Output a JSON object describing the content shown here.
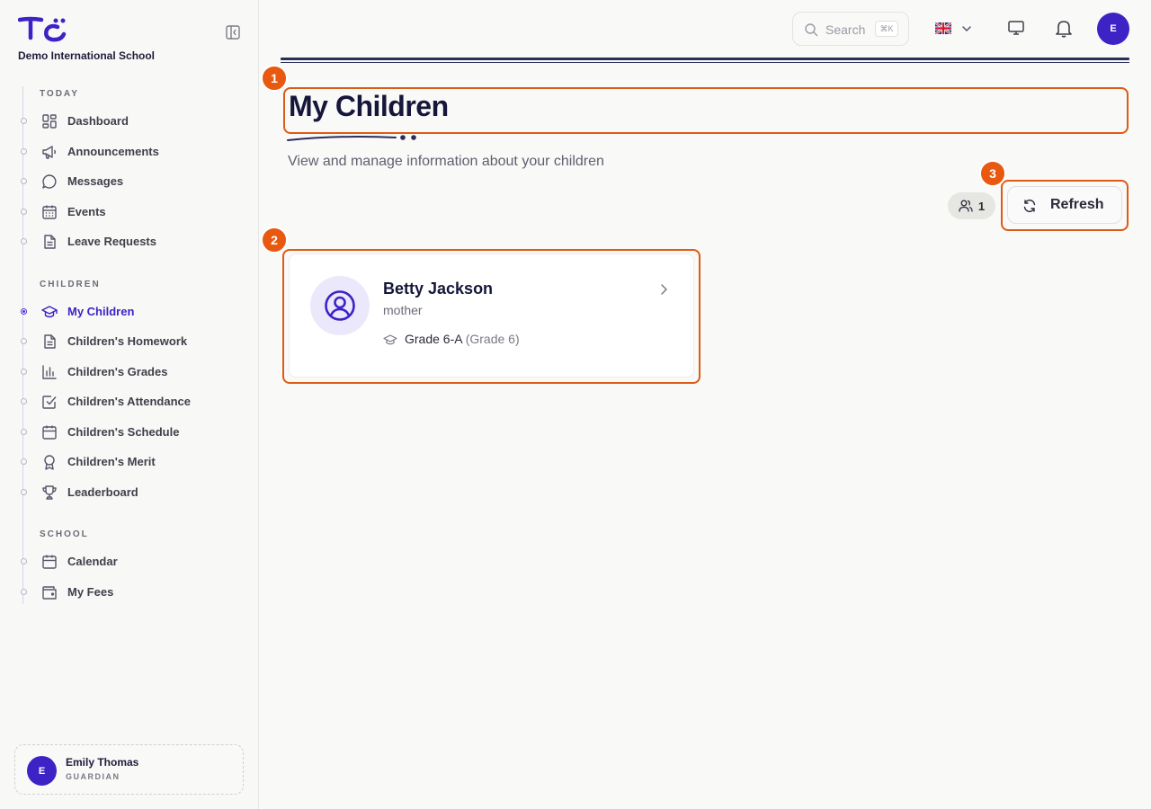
{
  "sidebar": {
    "school_name": "Demo International School",
    "sections": {
      "today": "TODAY",
      "children": "CHILDREN",
      "school": "SCHOOL"
    },
    "items": [
      {
        "label": "Dashboard",
        "icon": "dashboard-icon"
      },
      {
        "label": "Announcements",
        "icon": "megaphone-icon"
      },
      {
        "label": "Messages",
        "icon": "chat-bubble-icon"
      },
      {
        "label": "Events",
        "icon": "calendar-grid-icon"
      },
      {
        "label": "Leave Requests",
        "icon": "document-icon"
      },
      {
        "label": "My Children",
        "icon": "graduation-cap-icon",
        "active": true
      },
      {
        "label": "Children's Homework",
        "icon": "document-icon"
      },
      {
        "label": "Children's Grades",
        "icon": "bar-chart-icon"
      },
      {
        "label": "Children's Attendance",
        "icon": "checkbox-icon"
      },
      {
        "label": "Children's Schedule",
        "icon": "calendar-icon"
      },
      {
        "label": "Children's Merit",
        "icon": "award-icon"
      },
      {
        "label": "Leaderboard",
        "icon": "trophy-icon"
      },
      {
        "label": "Calendar",
        "icon": "calendar-icon"
      },
      {
        "label": "My Fees",
        "icon": "wallet-icon"
      }
    ],
    "user": {
      "initial": "E",
      "name": "Emily Thomas",
      "role": "GUARDIAN"
    }
  },
  "topbar": {
    "search_placeholder": "Search",
    "search_shortcut": "⌘K",
    "language": "en-GB",
    "avatar_initial": "E"
  },
  "main": {
    "title": "My Children",
    "subtitle": "View and manage information about your children",
    "children_count": "1",
    "refresh_label": "Refresh",
    "children": [
      {
        "name": "Betty Jackson",
        "relation": "mother",
        "class_name": "Grade 6-A",
        "grade_level": "(Grade 6)"
      }
    ]
  },
  "annotations": [
    "1",
    "2",
    "3"
  ],
  "colors": {
    "accent": "#3d22c6",
    "annotation": "#e8580f",
    "title": "#15163a"
  }
}
